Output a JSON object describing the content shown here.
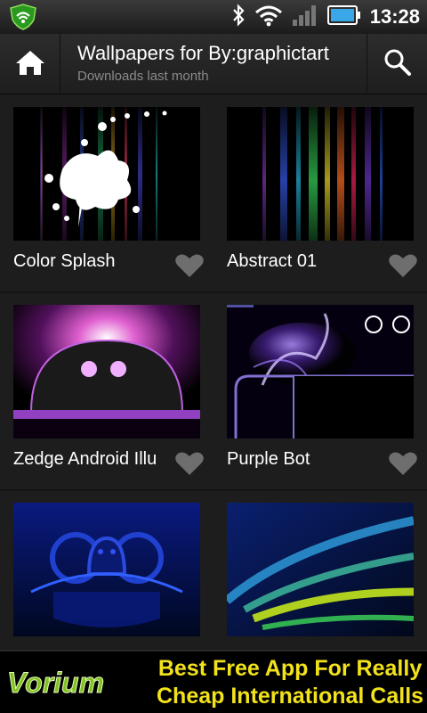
{
  "status_bar": {
    "time": "13:28",
    "icons": [
      "shield-app-icon",
      "bluetooth-icon",
      "wifi-icon",
      "signal-icon",
      "battery-icon"
    ]
  },
  "action_bar": {
    "title": "Wallpapers for By:graphictart",
    "subtitle": "Downloads last month",
    "home_icon": "home-icon",
    "search_icon": "search-icon"
  },
  "wallpapers": [
    {
      "label": "Color Splash"
    },
    {
      "label": "Abstract 01"
    },
    {
      "label": "Zedge Android Illu"
    },
    {
      "label": "Purple Bot"
    },
    {
      "label": ""
    },
    {
      "label": ""
    }
  ],
  "ad": {
    "logo_text": "Vorium",
    "line1": "Best Free App For Really",
    "line2": "Cheap International Calls"
  },
  "colors": {
    "accent_yellow": "#f2e21b",
    "logo_green": "#7ec21e"
  }
}
